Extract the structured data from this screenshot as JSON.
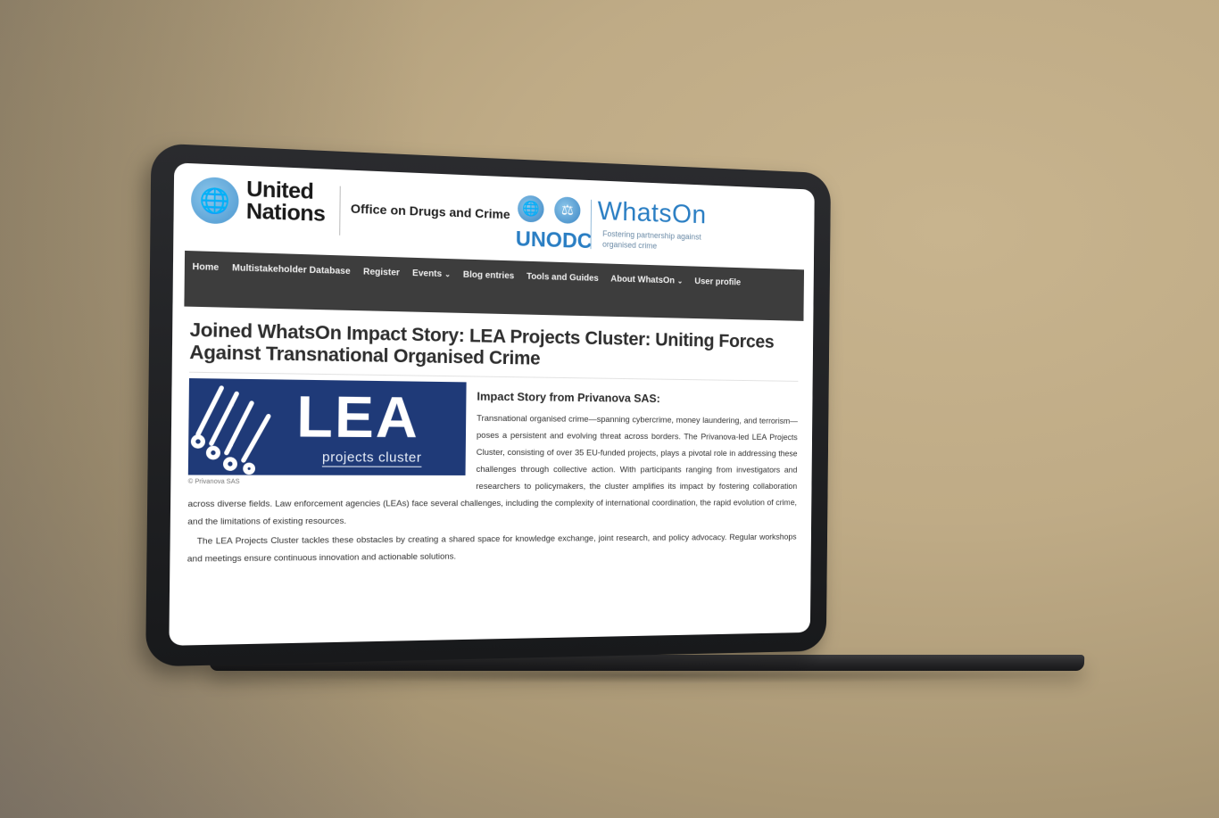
{
  "header": {
    "un_name_line1": "United",
    "un_name_line2": "Nations",
    "office_label": "Office on Drugs and Crime",
    "unodc_label": "UNODC",
    "whatson_title": "WhatsOn",
    "whatson_tagline": "Fostering partnership against organised crime"
  },
  "nav": {
    "items": [
      {
        "label": "Home"
      },
      {
        "label": "Multistakeholder Database"
      },
      {
        "label": "Register"
      },
      {
        "label": "Events"
      },
      {
        "label": "Blog entries"
      },
      {
        "label": "Tools and Guides"
      },
      {
        "label": "About WhatsOn"
      },
      {
        "label": "User profile"
      }
    ],
    "dropdown_caret": "⌄"
  },
  "article": {
    "title": "Joined WhatsOn Impact Story: LEA Projects Cluster: Uniting Forces Against Transnational Organised Crime",
    "image": {
      "logo_text": "LEA",
      "logo_subtext": "projects cluster",
      "credit": "© Privanova SAS"
    },
    "story_heading": "Impact Story from Privanova SAS:",
    "paragraph_1": "Transnational organised crime—spanning cybercrime, money laundering, and terrorism—poses a persistent and evolving threat across borders. The Privanova-led LEA Projects Cluster, consisting of over 35 EU-funded projects, plays a pivotal role in addressing these challenges through collective action. With participants ranging from investigators and researchers to policymakers, the cluster amplifies its impact by fostering collaboration across diverse fields. Law enforcement agencies (LEAs) face several challenges, including the complexity of international coordination, the rapid evolution of crime, and the limitations of existing resources.",
    "paragraph_2": "The LEA Projects Cluster tackles these obstacles by creating a shared space for knowledge exchange, joint research, and policy advocacy. Regular workshops and meetings ensure continuous innovation and actionable solutions."
  },
  "colors": {
    "nav_background": "#3d3d3d",
    "un_blue": "#4b97d0",
    "unodc_blue": "#2a7ec3",
    "lea_navy": "#1f3a78",
    "background_tan": "#c2ae89",
    "device_frame": "#1f2022"
  },
  "icons": {
    "un_emblem": "un-emblem-icon",
    "unodc_emblem": "unodc-emblem-icon"
  }
}
